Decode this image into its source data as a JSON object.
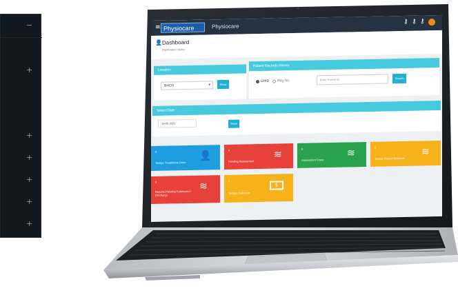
{
  "app": {
    "brand": "Physiocare",
    "title": "Physiocare",
    "menu_icon": "hamburger-icon",
    "header_icons": [
      "key-icon",
      "key-icon",
      "key-icon",
      "user-avatar-icon"
    ]
  },
  "page": {
    "heading": "Dashboard",
    "breadcrumb": "Dashboard / Index"
  },
  "location_panel": {
    "title": "Location",
    "select_value": "BHOS",
    "show_label": "Show"
  },
  "patient_panel": {
    "title": "Patient Records History",
    "radio_uhid": "UHID",
    "radio_reg": "Reg No.",
    "input_placeholder": "Enter Patient ID",
    "search_label": "Search"
  },
  "date_panel": {
    "title": "Select Date",
    "date_value": "19-05-2021",
    "show_label": "Show"
  },
  "tiles": [
    {
      "count": "0",
      "label": "Todays Treatments Done",
      "color": "#1e9ee0",
      "icon": "user-icon"
    },
    {
      "count": "0",
      "label": "Pending Assessment",
      "color": "#e8413a",
      "icon": "layers-icon"
    },
    {
      "count": "0",
      "label": "Assessment Done",
      "color": "#2aa34f",
      "icon": "layers-icon"
    },
    {
      "count": "0",
      "label": "Todays Patient Referrals",
      "color": "#f6b21a",
      "icon": "layers-icon"
    },
    {
      "count": "0",
      "label": "Reports Pending Submission Discharge",
      "color": "#e8413a",
      "icon": "layers-icon"
    },
    {
      "count": "0",
      "label": "Todays Collection",
      "color": "#f6b21a",
      "icon": "money-icon"
    }
  ],
  "colors": {
    "panel_header": "#47c9de",
    "topbar": "#263240",
    "button": "#1fb0d3"
  }
}
